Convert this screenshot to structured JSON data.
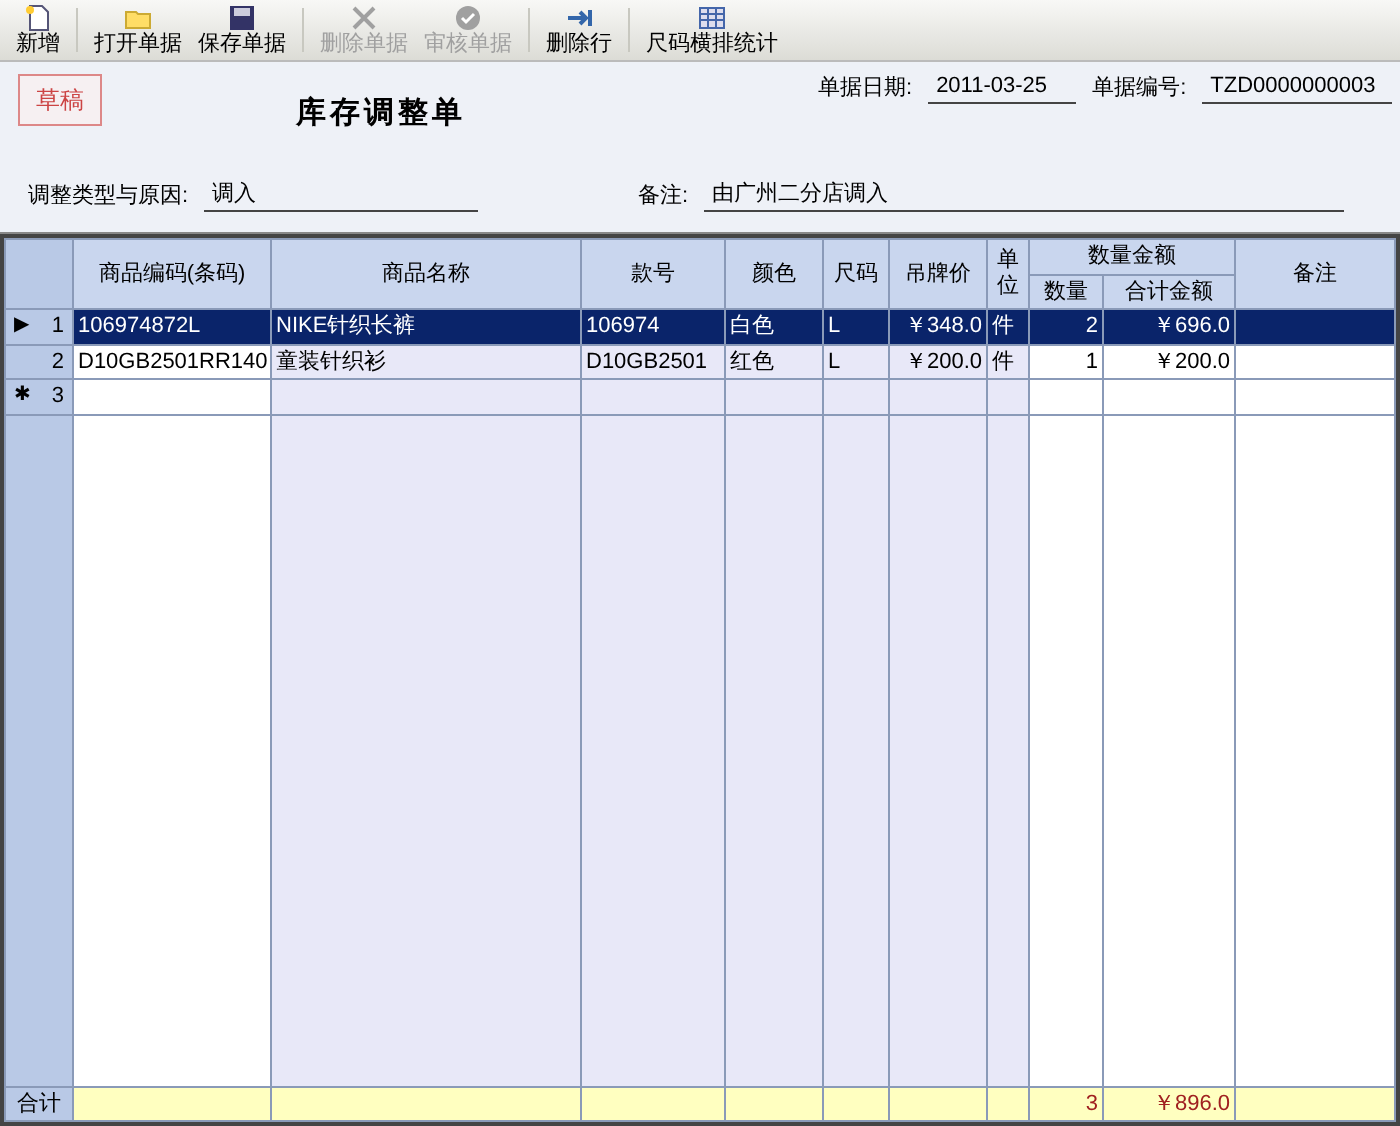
{
  "toolbar": [
    {
      "label": "新增",
      "kind": "new",
      "disabled": false
    },
    {
      "label": "打开单据",
      "kind": "open",
      "disabled": false
    },
    {
      "label": "保存单据",
      "kind": "save",
      "disabled": false
    },
    {
      "label": "删除单据",
      "kind": "delete",
      "disabled": true
    },
    {
      "label": "审核单据",
      "kind": "approve",
      "disabled": true
    },
    {
      "label": "删除行",
      "kind": "removerow",
      "disabled": false
    },
    {
      "label": "尺码横排统计",
      "kind": "grid",
      "disabled": false
    }
  ],
  "status_stamp": "草稿",
  "title": "库存调整单",
  "fields": {
    "date": {
      "label": "单据日期:",
      "value": "2011-03-25"
    },
    "number": {
      "label": "单据编号:",
      "value": "TZD0000000003"
    },
    "reason": {
      "label": "调整类型与原因:",
      "value": "调入"
    },
    "remark": {
      "label": "备注:",
      "value": "由广州二分店调入"
    }
  },
  "table": {
    "group_header": "数量金额",
    "columns": [
      {
        "label": "商品编码(条码)",
        "tint": false,
        "kind": "text"
      },
      {
        "label": "商品名称",
        "tint": true,
        "kind": "text"
      },
      {
        "label": "款号",
        "tint": true,
        "kind": "text"
      },
      {
        "label": "颜色",
        "tint": true,
        "kind": "text"
      },
      {
        "label": "尺码",
        "tint": true,
        "kind": "text"
      },
      {
        "label": "吊牌价",
        "tint": true,
        "kind": "number"
      },
      {
        "label": "单位",
        "tint": true,
        "kind": "text"
      },
      {
        "label": "数量",
        "tint": false,
        "kind": "number",
        "group": true
      },
      {
        "label": "合计金额",
        "tint": false,
        "kind": "number",
        "group": true
      },
      {
        "label": "备注",
        "tint": false,
        "kind": "text"
      }
    ],
    "rows": [
      {
        "number": "1",
        "marker": "▶",
        "selected": true,
        "cells": [
          "106974872L",
          "NIKE针织长裤",
          "106974",
          "白色",
          "L",
          "￥348.0",
          "件",
          "2",
          "￥696.0",
          ""
        ]
      },
      {
        "number": "2",
        "selected": false,
        "cells": [
          "D10GB2501RR140",
          "童装针织衫",
          "D10GB2501",
          "红色",
          "L",
          "￥200.0",
          "件",
          "1",
          "￥200.0",
          ""
        ]
      },
      {
        "number": "3",
        "marker": "✱",
        "selected": false,
        "cells": [
          "",
          "",
          "",
          "",
          "",
          "",
          "",
          "",
          "",
          ""
        ]
      }
    ],
    "totals": {
      "label": "合计",
      "cells": [
        "",
        "",
        "",
        "",
        "",
        "",
        "",
        "3",
        "￥896.0",
        ""
      ]
    }
  }
}
